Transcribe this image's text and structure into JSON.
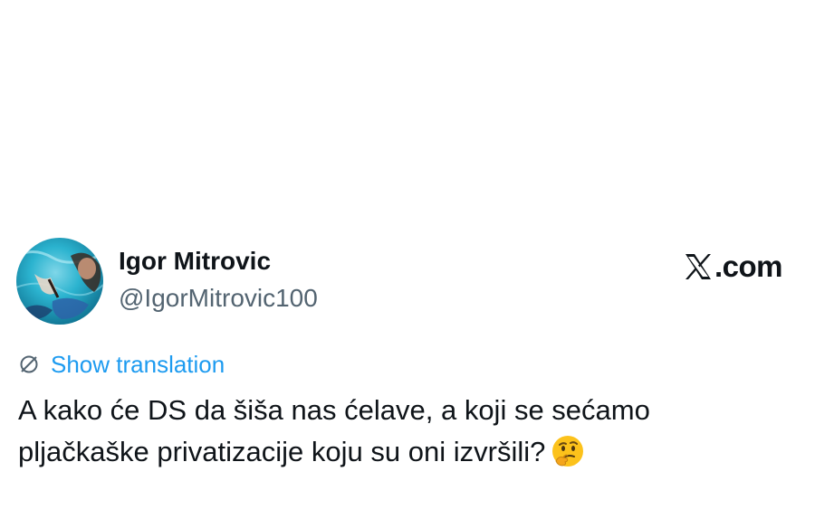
{
  "author": {
    "display_name": "Igor Mitrovic",
    "handle": "@IgorMitrovic100"
  },
  "brand": {
    "logo_icon": "x-logo-icon",
    "label": ".com"
  },
  "translation": {
    "icon": "globe-icon",
    "label": "Show translation",
    "color": "#1d9bf0"
  },
  "tweet": {
    "lines": [
      "A kako će DS da šiša nas ćelave, a koji se sećamo",
      "pljačkaške privatizacije koju su oni izvršili?"
    ],
    "emoji": "thinking-face-emoji"
  },
  "colors": {
    "text_primary": "#0f1419",
    "text_secondary": "#536471",
    "link": "#1d9bf0",
    "background": "#ffffff"
  }
}
